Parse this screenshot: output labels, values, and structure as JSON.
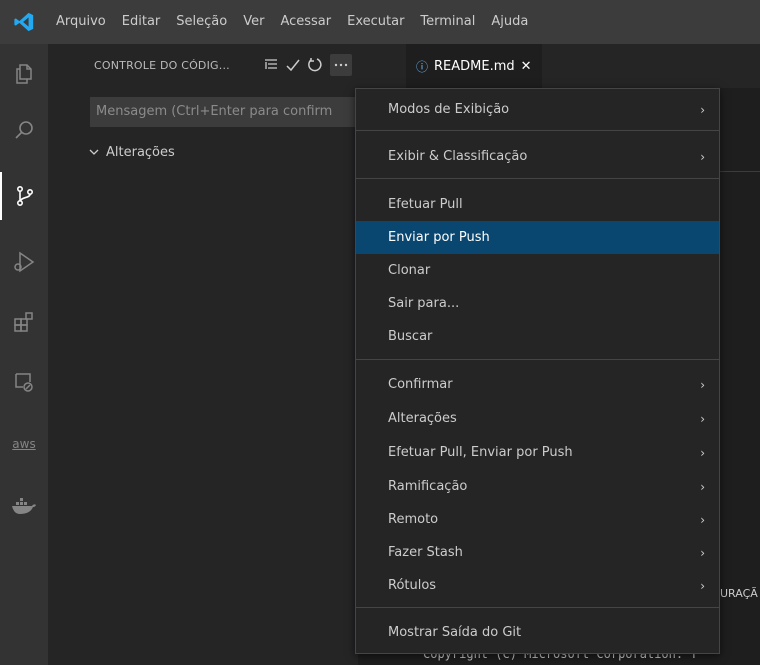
{
  "menubar": {
    "items": [
      "Arquivo",
      "Editar",
      "Seleção",
      "Ver",
      "Acessar",
      "Executar",
      "Terminal",
      "Ajuda"
    ]
  },
  "activitybar": {
    "items": [
      {
        "icon": "explorer-icon"
      },
      {
        "icon": "search-icon"
      },
      {
        "icon": "source-control-icon",
        "active": true
      },
      {
        "icon": "run-debug-icon"
      },
      {
        "icon": "extensions-icon"
      },
      {
        "icon": "remote-explorer-icon"
      },
      {
        "icon": "aws-icon",
        "text": "aws"
      },
      {
        "icon": "docker-icon"
      }
    ]
  },
  "sidebar": {
    "title": "CONTROLE DO CÓDIG...",
    "commit_placeholder": "Mensagem (Ctrl+Enter para confirm",
    "changes_label": "Alterações"
  },
  "editor": {
    "tab_label": "README.md",
    "tab_close": "✕",
    "terminal_label_fragment": "URAÇÃ",
    "copyright_fragment": "Copyright (C) Microsoft Corporation. T"
  },
  "context_menu": {
    "items": [
      {
        "label": "Modos de Exibição",
        "submenu": true
      },
      {
        "label": "Exibir & Classificação",
        "submenu": true
      },
      {
        "label": "Efetuar Pull",
        "submenu": false
      },
      {
        "label": "Enviar por Push",
        "submenu": false,
        "highlighted": true
      },
      {
        "label": "Clonar",
        "submenu": false
      },
      {
        "label": "Sair para...",
        "submenu": false
      },
      {
        "label": "Buscar",
        "submenu": false
      },
      {
        "label": "Confirmar",
        "submenu": true
      },
      {
        "label": "Alterações",
        "submenu": true
      },
      {
        "label": "Efetuar Pull, Enviar por Push",
        "submenu": true
      },
      {
        "label": "Ramificação",
        "submenu": true
      },
      {
        "label": "Remoto",
        "submenu": true
      },
      {
        "label": "Fazer Stash",
        "submenu": true
      },
      {
        "label": "Rótulos",
        "submenu": true
      },
      {
        "label": "Mostrar Saída do Git",
        "submenu": false
      }
    ],
    "submenu_arrow": "›"
  },
  "colors": {
    "titlebar": "#3c3c3c",
    "activitybar": "#333333",
    "sidebar": "#252526",
    "editor": "#1e1e1e",
    "menu_highlight": "#094771",
    "accent_logo": "#23a9f2"
  }
}
